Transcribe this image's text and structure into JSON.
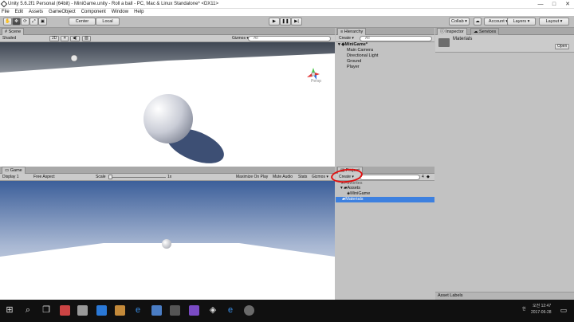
{
  "window": {
    "title": "Unity 5.6.2f1 Personal (64bit) - MiniGame.unity - Roll a ball - PC, Mac & Linux Standalone* <DX11>",
    "minimize": "—",
    "maximize": "□",
    "close": "✕"
  },
  "menu": [
    "File",
    "Edit",
    "Assets",
    "GameObject",
    "Component",
    "Window",
    "Help"
  ],
  "toolbar": {
    "pivot": "Center",
    "space": "Local",
    "collab": "Collab ▾",
    "account": "Account ▾",
    "layers": "Layers ▾",
    "layout": "Layout ▾"
  },
  "scene": {
    "tab": "Scene",
    "shading": "Shaded",
    "mode_2d": "2D",
    "gizmos": "Gizmos ▾",
    "search_placeholder": "All",
    "persp_label": "Persp"
  },
  "game": {
    "tab": "Game",
    "display": "Display 1",
    "aspect": "Free Aspect",
    "scale_label": "Scale",
    "scale_value": "1x",
    "maximize_on_play": "Maximize On Play",
    "mute_audio": "Mute Audio",
    "stats": "Stats",
    "gizmos": "Gizmos ▾"
  },
  "hierarchy": {
    "tab": "Hierarchy",
    "create": "Create ▾",
    "search_placeholder": "All",
    "scene_name": "MiniGame*",
    "items": [
      "Main Camera",
      "Directional Light",
      "Ground",
      "Player"
    ]
  },
  "project": {
    "tab": "Project",
    "create": "Create ▾",
    "count": "4",
    "favorites": "Favorites",
    "assets": "Assets",
    "minigame": "MiniGame",
    "materials": "Materials"
  },
  "inspector": {
    "tab": "Inspector",
    "services_tab": "Services",
    "object_name": "Materials",
    "open_button": "Open",
    "asset_labels": "Asset Labels"
  },
  "taskbar": {
    "time": "오전 12:47",
    "date": "2017-06-28",
    "lang": "한"
  },
  "colors": {
    "selection": "#3d80df",
    "annotation_circle": "#e01010",
    "unity_bg": "#c2c2c2"
  }
}
